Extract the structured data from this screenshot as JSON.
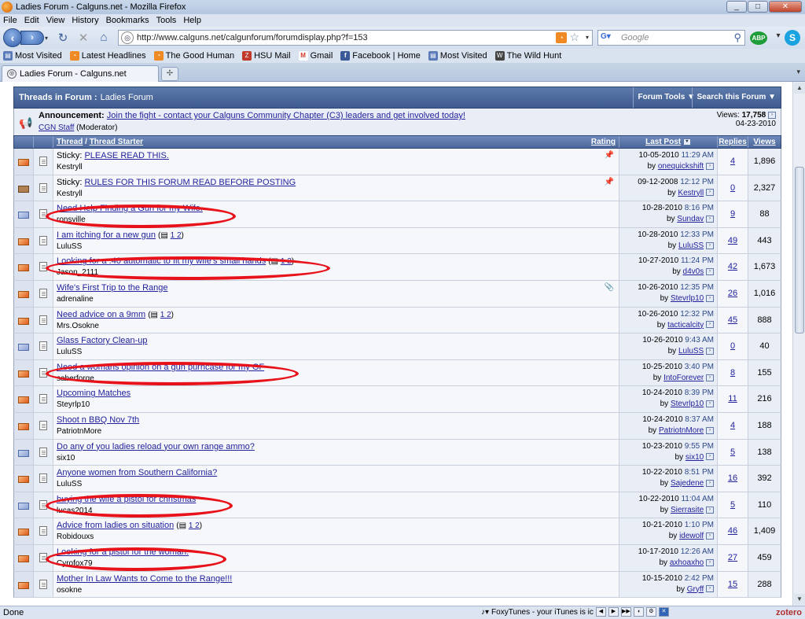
{
  "window": {
    "title": "Ladies Forum - Calguns.net - Mozilla Firefox",
    "buttons": {
      "minimize": "_",
      "maximize": "□",
      "close": "✕"
    }
  },
  "menu": [
    "File",
    "Edit",
    "View",
    "History",
    "Bookmarks",
    "Tools",
    "Help"
  ],
  "nav": {
    "url": "http://www.calguns.net/calgunforum/forumdisplay.php?f=153",
    "search_placeholder": "Google",
    "abp": "ABP",
    "search_engine_icon": "google-icon"
  },
  "bookmarks": [
    {
      "label": "Most Visited",
      "icon": "bookmark-icon",
      "color": "#5a7ab8"
    },
    {
      "label": "Latest Headlines",
      "icon": "rss-icon",
      "color": "#f08a24"
    },
    {
      "label": "The Good Human",
      "icon": "rss-icon",
      "color": "#f08a24"
    },
    {
      "label": "HSU Mail",
      "icon": "hsu-mail-icon",
      "color": "#c0392b"
    },
    {
      "label": "Gmail",
      "icon": "gmail-icon",
      "color": "#d43a2c"
    },
    {
      "label": "Facebook | Home",
      "icon": "facebook-icon",
      "color": "#3b5998"
    },
    {
      "label": "Most Visited",
      "icon": "bookmark-icon",
      "color": "#5a7ab8"
    },
    {
      "label": "The Wild Hunt",
      "icon": "wild-hunt-icon",
      "color": "#444"
    }
  ],
  "tab": {
    "label": "Ladies Forum - Calguns.net"
  },
  "forum": {
    "header_label": "Threads in Forum",
    "header_sep": ":",
    "header_name": "Ladies Forum",
    "forum_tools": "Forum Tools",
    "search_forum": "Search this Forum",
    "announcement": {
      "label": "Announcement:",
      "link": "Join the fight - contact your Calguns Community Chapter (C3) leaders and get involved today!",
      "author": "CGN Staff",
      "author_role": "(Moderator)",
      "views_label": "Views:",
      "views": "17,758",
      "date": "04-23-2010"
    },
    "columns": {
      "thread": "Thread",
      "sep": "/",
      "starter": "Thread Starter",
      "rating": "Rating",
      "last_post": "Last Post",
      "replies": "Replies",
      "views": "Views"
    },
    "threads": [
      {
        "prefix": "Sticky:",
        "title": "PLEASE READ THIS.",
        "starter": "Kestryll",
        "date": "10-05-2010",
        "time": "11:29 AM",
        "by": "onequickshift",
        "replies": "4",
        "views": "1,896",
        "status": "hot",
        "pin": true
      },
      {
        "prefix": "Sticky:",
        "title": "RULES FOR THIS FORUM READ BEFORE POSTING",
        "starter": "Kestryll",
        "date": "09-12-2008",
        "time": "12:12 PM",
        "by": "Kestryll",
        "replies": "0",
        "views": "2,327",
        "status": "lock",
        "pin": true
      },
      {
        "prefix": "",
        "title": "Need Help Finding a Gun for my Wife.",
        "starter": "ronsville",
        "date": "10-28-2010",
        "time": "8:16 PM",
        "by": "Sundav",
        "replies": "9",
        "views": "88",
        "status": "cold"
      },
      {
        "prefix": "",
        "title": "I am itching for a new gun",
        "pages": "1 2",
        "starter": "LuluSS",
        "date": "10-28-2010",
        "time": "12:33 PM",
        "by": "LuluSS",
        "replies": "49",
        "views": "443",
        "status": "hot"
      },
      {
        "prefix": "",
        "title": "Looking for a .40 automatic to fit my wife's small hands",
        "pages": "1 2",
        "starter": "Jason_2111",
        "date": "10-27-2010",
        "time": "11:24 PM",
        "by": "d4v0s",
        "replies": "42",
        "views": "1,673",
        "status": "hot"
      },
      {
        "prefix": "",
        "title": "Wife's First Trip to the Range",
        "starter": "adrenaline",
        "date": "10-26-2010",
        "time": "12:35 PM",
        "by": "Stevrlp10",
        "replies": "26",
        "views": "1,016",
        "status": "hot",
        "clip": true
      },
      {
        "prefix": "",
        "title": "Need advice on a 9mm",
        "pages": "1 2",
        "starter": "Mrs.Osokne",
        "date": "10-26-2010",
        "time": "12:32 PM",
        "by": "tacticalcity",
        "replies": "45",
        "views": "888",
        "status": "hot"
      },
      {
        "prefix": "",
        "title": "Glass Factory Clean-up",
        "starter": "LuluSS",
        "date": "10-26-2010",
        "time": "9:43 AM",
        "by": "LuluSS",
        "replies": "0",
        "views": "40",
        "status": "cold"
      },
      {
        "prefix": "",
        "title": "Need a womans opinion on a gun purhcase for my GF",
        "starter": "saberforge",
        "date": "10-25-2010",
        "time": "3:40 PM",
        "by": "IntoForever",
        "replies": "8",
        "views": "155",
        "status": "hot"
      },
      {
        "prefix": "",
        "title": "Upcoming Matches",
        "starter": "Steyrlp10",
        "date": "10-24-2010",
        "time": "8:39 PM",
        "by": "Stevrlp10",
        "replies": "11",
        "views": "216",
        "status": "hot"
      },
      {
        "prefix": "",
        "title": "Shoot n BBQ Nov 7th",
        "starter": "PatriotnMore",
        "date": "10-24-2010",
        "time": "8:37 AM",
        "by": "PatriotnMore",
        "replies": "4",
        "views": "188",
        "status": "hot"
      },
      {
        "prefix": "",
        "title": "Do any of you ladies reload your own range ammo?",
        "starter": "six10",
        "date": "10-23-2010",
        "time": "9:55 PM",
        "by": "six10",
        "replies": "5",
        "views": "138",
        "status": "cold"
      },
      {
        "prefix": "",
        "title": "Anyone women from Southern California?",
        "starter": "LuluSS",
        "date": "10-22-2010",
        "time": "8:51 PM",
        "by": "Sajedene",
        "replies": "16",
        "views": "392",
        "status": "hot"
      },
      {
        "prefix": "",
        "title": "buying the wife a pistol for christmas",
        "starter": "lucas2014",
        "date": "10-22-2010",
        "time": "11:04 AM",
        "by": "Sierrasite",
        "replies": "5",
        "views": "110",
        "status": "cold"
      },
      {
        "prefix": "",
        "title": "Advice from ladies on situation",
        "pages": "1 2",
        "starter": "Robidouxs",
        "date": "10-21-2010",
        "time": "1:10 PM",
        "by": "idewolf",
        "replies": "46",
        "views": "1,409",
        "status": "hot"
      },
      {
        "prefix": "",
        "title": "Looking for a pistol for the woman.",
        "starter": "Cyrofox79",
        "date": "10-17-2010",
        "time": "12:26 AM",
        "by": "axhoaxho",
        "replies": "27",
        "views": "459",
        "status": "hot"
      },
      {
        "prefix": "",
        "title": "Mother In Law Wants to Come to the Range!!!",
        "starter": "osokne",
        "date": "10-15-2010",
        "time": "2:42 PM",
        "by": "Gryff",
        "replies": "15",
        "views": "288",
        "status": "hot"
      }
    ]
  },
  "statusbar": {
    "status": "Done",
    "foxytunes": "FoxyTunes - your iTunes is ic",
    "zotero": "zotero"
  }
}
